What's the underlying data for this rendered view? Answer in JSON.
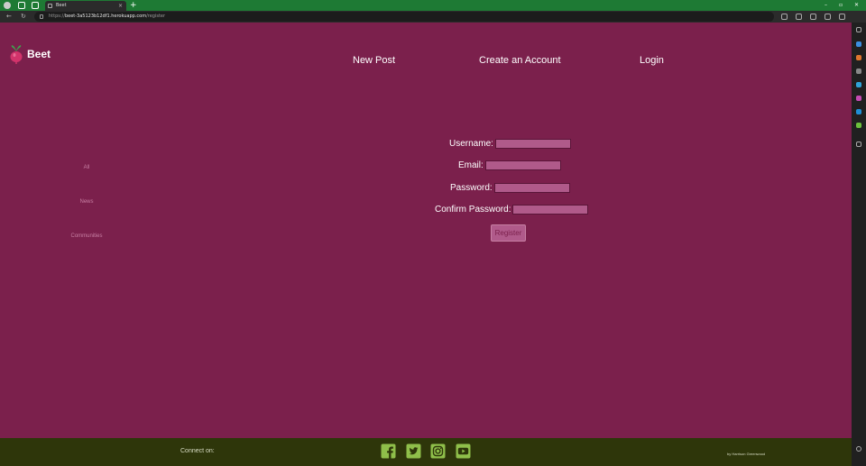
{
  "browser": {
    "tab_title": "Beet",
    "tab_close": "×",
    "new_tab": "+",
    "url_host": "beet-3a5123b12df1.herokuapp.com",
    "url_path": "/register",
    "url_scheme": "https://",
    "window_controls": [
      "–",
      "▫",
      "✕"
    ]
  },
  "header": {
    "logo_text": "Beet",
    "nav": [
      {
        "label": "New Post"
      },
      {
        "label": "Create an Account"
      },
      {
        "label": "Login"
      }
    ]
  },
  "sidebar": {
    "items": [
      {
        "label": "All"
      },
      {
        "label": "News"
      },
      {
        "label": "Communities"
      }
    ]
  },
  "form": {
    "fields": [
      {
        "label": "Username:",
        "value": ""
      },
      {
        "label": "Email:",
        "value": ""
      },
      {
        "label": "Password:",
        "value": ""
      },
      {
        "label": "Confirm Password:",
        "value": ""
      }
    ],
    "submit_label": "Register"
  },
  "footer": {
    "connect_label": "Connect on:",
    "social_icons": [
      "facebook-icon",
      "twitter-icon",
      "instagram-icon",
      "youtube-icon"
    ],
    "credit": "by Harrison Greenwood"
  },
  "colors": {
    "page_bg": "#7b204c",
    "footer_bg": "#2e360a",
    "input_bg": "#b05a8a",
    "social_icon": "#8fbf4a",
    "browser_title_bar": "#1e7a34"
  }
}
